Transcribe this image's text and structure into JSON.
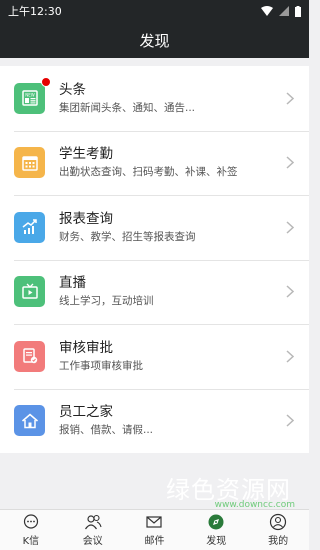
{
  "status": {
    "time": "上午12:30"
  },
  "header": {
    "title": "发现"
  },
  "items": [
    {
      "title": "头条",
      "subtitle": "集团新闻头条、通知、通告...",
      "color": "#4dc07a",
      "icon": "news-icon",
      "badge": true
    },
    {
      "title": "学生考勤",
      "subtitle": "出勤状态查询、扫码考勤、补课、补签",
      "color": "#f5b54a",
      "icon": "calendar-icon",
      "badge": false
    },
    {
      "title": "报表查询",
      "subtitle": "财务、教学、招生等报表查询",
      "color": "#4aa8e8",
      "icon": "chart-icon",
      "badge": false
    },
    {
      "title": "直播",
      "subtitle": "线上学习，互动培训",
      "color": "#4dc07a",
      "icon": "tv-icon",
      "badge": false
    },
    {
      "title": "审核审批",
      "subtitle": "工作事项审核审批",
      "color": "#f27b7b",
      "icon": "document-approve-icon",
      "badge": false
    },
    {
      "title": "员工之家",
      "subtitle": "报销、借款、请假...",
      "color": "#5b93e6",
      "icon": "home-icon",
      "badge": false
    }
  ],
  "tabs": [
    {
      "label": "K信",
      "icon": "chat-icon"
    },
    {
      "label": "会议",
      "icon": "users-icon"
    },
    {
      "label": "邮件",
      "icon": "mail-icon"
    },
    {
      "label": "发现",
      "icon": "discover-icon",
      "active": true
    },
    {
      "label": "我的",
      "icon": "profile-icon"
    }
  ],
  "watermark": {
    "text": "绿色资源网",
    "url": "www.downcc.com"
  }
}
